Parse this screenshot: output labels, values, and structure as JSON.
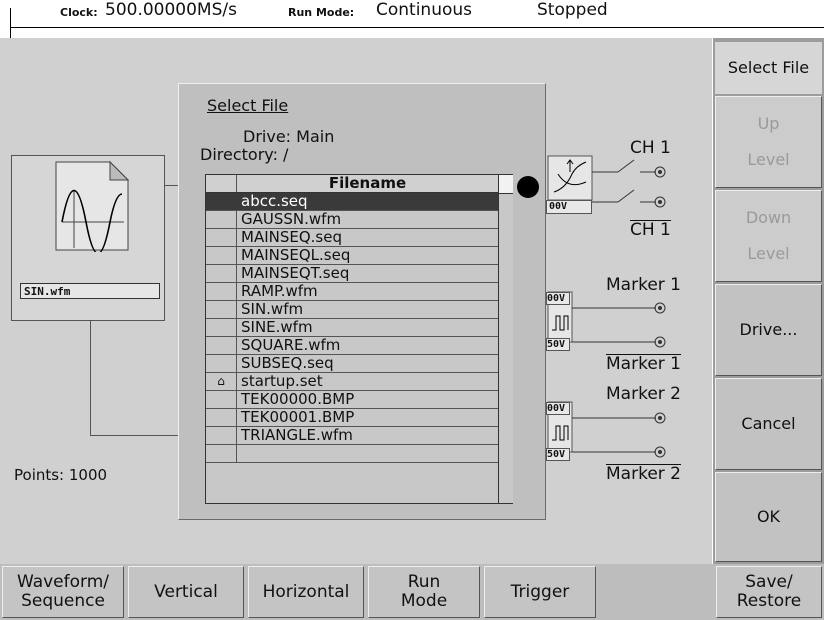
{
  "status_bar": {
    "clock_label": "Clock:",
    "clock_value": "500.00000MS/s",
    "run_mode_label": "Run Mode:",
    "run_mode_value": "Continuous",
    "state": "Stopped"
  },
  "waveform": {
    "file_label": "SIN.wfm",
    "points_label": "Points: 1000"
  },
  "dialog": {
    "title": "Select File",
    "drive_label": "Drive: Main",
    "directory_label": "Directory: /",
    "column_header": "Filename",
    "files": [
      {
        "name": "abcc.seq",
        "selected": true,
        "locked": false
      },
      {
        "name": "GAUSSN.wfm",
        "selected": false,
        "locked": false
      },
      {
        "name": "MAINSEQ.seq",
        "selected": false,
        "locked": false
      },
      {
        "name": "MAINSEQL.seq",
        "selected": false,
        "locked": false
      },
      {
        "name": "MAINSEQT.seq",
        "selected": false,
        "locked": false
      },
      {
        "name": "RAMP.wfm",
        "selected": false,
        "locked": false
      },
      {
        "name": "SIN.wfm",
        "selected": false,
        "locked": false
      },
      {
        "name": "SINE.wfm",
        "selected": false,
        "locked": false
      },
      {
        "name": "SQUARE.wfm",
        "selected": false,
        "locked": false
      },
      {
        "name": "SUBSEQ.seq",
        "selected": false,
        "locked": false
      },
      {
        "name": "startup.set",
        "selected": false,
        "locked": true
      },
      {
        "name": "TEK00000.BMP",
        "selected": false,
        "locked": false
      },
      {
        "name": "TEK00001.BMP",
        "selected": false,
        "locked": false
      },
      {
        "name": "TRIANGLE.wfm",
        "selected": false,
        "locked": false
      },
      {
        "name": "",
        "selected": false,
        "locked": false
      }
    ]
  },
  "outputs": {
    "ch1": "CH 1",
    "ch1_bar": "CH 1",
    "ch1_scale": "00V",
    "marker1": "Marker 1",
    "marker1_bar": "Marker 1",
    "marker1_hi": "00V",
    "marker1_lo": "50V",
    "marker2": "Marker 2",
    "marker2_bar": "Marker 2",
    "marker2_hi": "00V",
    "marker2_lo": "50V"
  },
  "right_menu": {
    "title": "Select File",
    "up_level": "Up Level",
    "down_level": "Down Level",
    "drive": "Drive...",
    "cancel": "Cancel",
    "ok": "OK"
  },
  "bottom_menu": {
    "waveform_sequence": "Waveform/ Sequence",
    "vertical": "Vertical",
    "horizontal": "Horizontal",
    "run_mode": "Run Mode",
    "trigger": "Trigger",
    "save_restore": "Save/ Restore"
  },
  "colors": {
    "screen_bg": "#d0d0d0",
    "dialog_bg": "#bfbfbf",
    "selected_row": "#3a3a3a"
  }
}
